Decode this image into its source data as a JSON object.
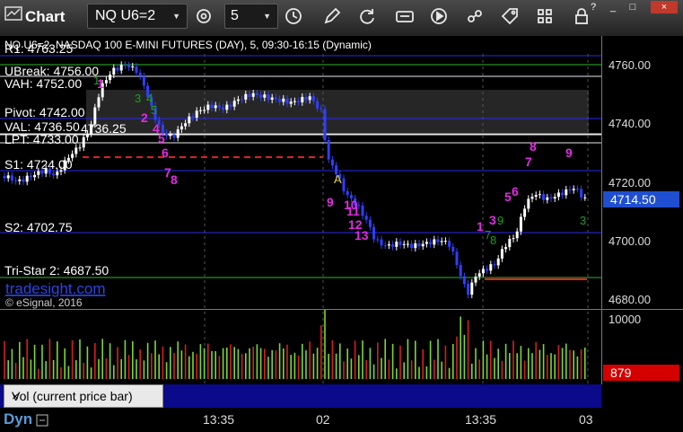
{
  "window": {
    "title": "Chart",
    "symbol": "NQ U6=2",
    "interval": "5",
    "help": "?",
    "minimize": "_",
    "maximize": "□",
    "close": "×"
  },
  "chart": {
    "header": "NQ U6=2, NASDAQ 100 E-MINI FUTURES (DAY), 5, 09:30-16:15 (Dynamic)",
    "watermark": "tradesight.com",
    "copyright": "© eSignal, 2016",
    "price_axis_ticks": [
      "4760.00",
      "4740.00",
      "4720.00",
      "4700.00",
      "4680.00"
    ],
    "last_price": "4714.50",
    "volume_axis_tick": "10000",
    "last_volume": "879",
    "volume_label": "Vol (current price bar)",
    "time_labels": [
      "13:35",
      "02",
      "13:35",
      "03"
    ],
    "dyn_label": "Dyn",
    "levels": [
      {
        "label": "R1: 4763.25",
        "color": "#2a2ae8"
      },
      {
        "label": "UBreak: 4756.00",
        "color": "#2db82d"
      },
      {
        "label": "VAH: 4752.00",
        "color": "#e8e8e8"
      },
      {
        "label": "Pivot: 4742.00",
        "color": "#2a2ae8"
      },
      {
        "label": "VAL: 4736.50",
        "color": "#e8e8e8"
      },
      {
        "label": "4736.25",
        "color": "#e8e8e8"
      },
      {
        "label": "LPT: 4733.00",
        "color": "#e8e8e8"
      },
      {
        "label": "S1: 4724.00",
        "color": "#2a2ae8"
      },
      {
        "label": "S2: 4702.75",
        "color": "#2a2ae8"
      },
      {
        "label": "Tri-Star 2: 4687.50",
        "color": "#2db82d"
      }
    ],
    "marker_text": "A",
    "count_labels_magenta": [
      "1",
      "2",
      "3",
      "4",
      "5",
      "6",
      "7",
      "8",
      "9",
      "10",
      "11",
      "12",
      "13",
      "1",
      "2",
      "3",
      "4",
      "5",
      "6",
      "7",
      "8",
      "9"
    ],
    "count_labels_green": [
      "1",
      "2",
      "3",
      "4",
      "5",
      "6",
      "7",
      "8",
      "9"
    ],
    "colors": {
      "up_bar": "#ffffff",
      "down_bar": "#2f3fff",
      "volume_up": "#7ad63a",
      "volume_down": "#d42020",
      "last_price_bg": "#1f4fd0",
      "last_volume_bg": "#d40000",
      "dyn": "#5b9bd5"
    }
  }
}
